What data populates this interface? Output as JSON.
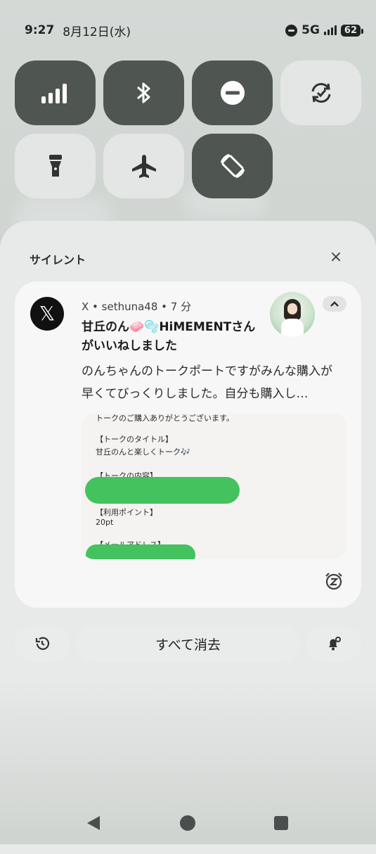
{
  "status_bar": {
    "time": "9:27",
    "date": "8月12日(水)",
    "network": "5G",
    "battery": "62",
    "dnd_icon": "do-not-disturb-icon",
    "signal_icon": "signal-icon"
  },
  "quick_settings": [
    {
      "name": "mobile-data",
      "icon": "signal-bars-icon",
      "state": "on"
    },
    {
      "name": "bluetooth",
      "icon": "bluetooth-icon",
      "state": "on"
    },
    {
      "name": "do-not-disturb",
      "icon": "do-not-disturb-icon",
      "state": "on"
    },
    {
      "name": "data-saver",
      "icon": "sync-icon",
      "state": "off"
    },
    {
      "name": "flashlight",
      "icon": "flashlight-icon",
      "state": "off"
    },
    {
      "name": "airplane-mode",
      "icon": "airplane-icon",
      "state": "off"
    },
    {
      "name": "auto-rotate",
      "icon": "rotate-icon",
      "state": "on"
    }
  ],
  "shade": {
    "section_label": "サイレント",
    "close_label": "×"
  },
  "notification": {
    "app_icon": "x-logo",
    "app_logo_text": "𝕏",
    "meta": "X • sethuna48 • 7 分",
    "title": "甘丘のん🧼🫧HiMEMENTさんがいいねしました",
    "body": "のんちゃんのトークポートですがみんな購入が早くてびっくりしました。自分も購入し…",
    "attachment": {
      "lines": [
        "トークのご購入ありがとうございます。",
        "【トークのタイトル】",
        "甘丘のんと楽しくトーク🎶",
        "【トークの内容】",
        "【利用ポイント】",
        "20pt",
        "【メールアドレス】"
      ]
    }
  },
  "actions": {
    "clear_all": "すべて消去",
    "history_icon": "history-icon",
    "settings_icon": "notification-settings-icon"
  },
  "colors": {
    "tile_on": "#4f5652",
    "tile_off": "#e3e6e4",
    "card": "#f6f7f6",
    "scribble": "#43c25d"
  }
}
